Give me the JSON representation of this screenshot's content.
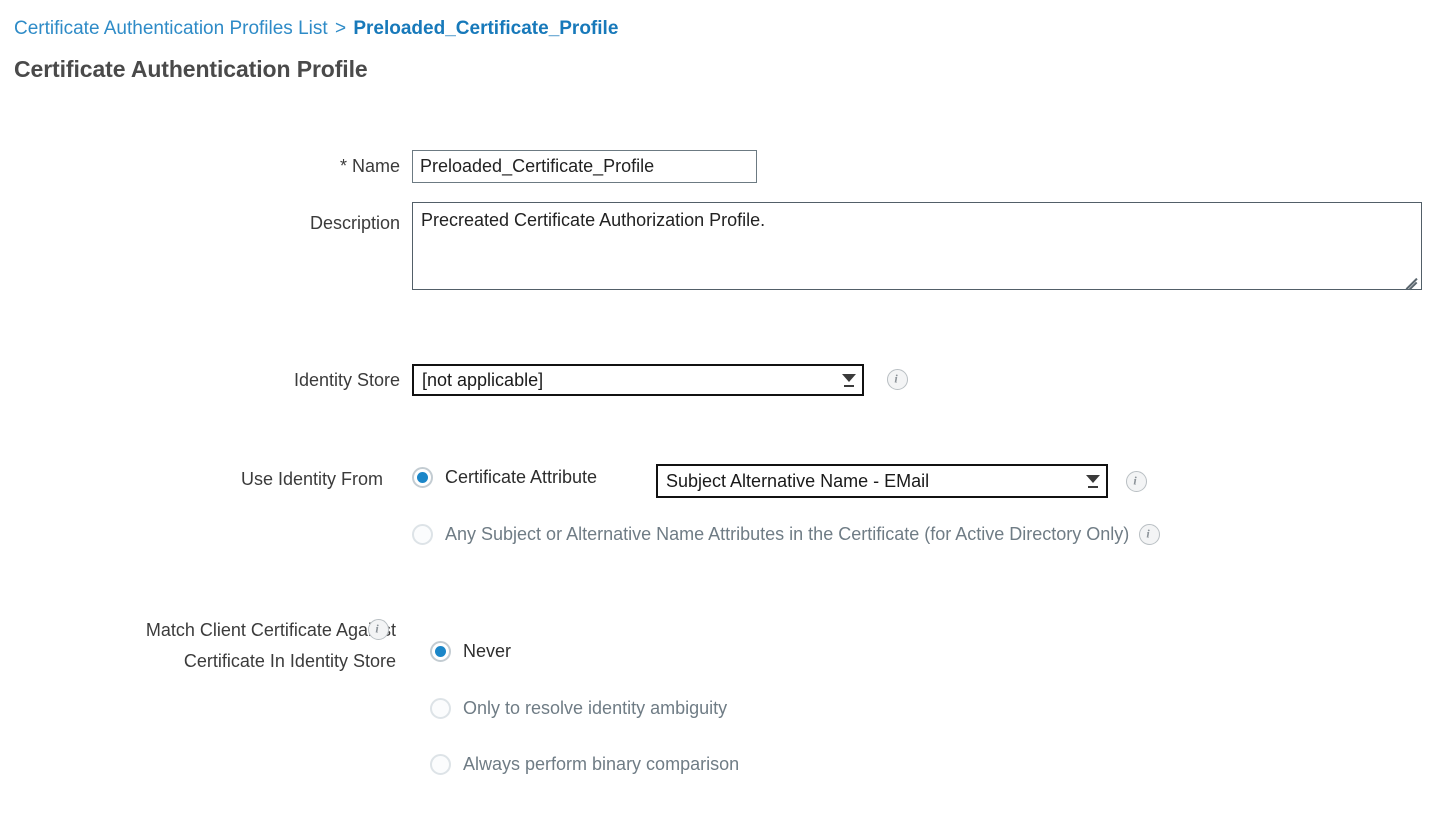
{
  "breadcrumb": {
    "parent": "Certificate Authentication Profiles List",
    "separator": ">",
    "current": "Preloaded_Certificate_Profile"
  },
  "page_title": "Certificate Authentication Profile",
  "form": {
    "name": {
      "label": "* Name",
      "value": "Preloaded_Certificate_Profile",
      "placeholder": ""
    },
    "description": {
      "label": "Description",
      "value": "Precreated Certificate Authorization Profile.",
      "placeholder": ""
    },
    "identity_store": {
      "label": "Identity Store",
      "value": "[not applicable]",
      "options": [
        "[not applicable]"
      ],
      "info_icon": "info-icon"
    },
    "use_identity_from": {
      "label": "Use Identity From",
      "option_certificate_attribute": {
        "label": "Certificate Attribute",
        "selected": true
      },
      "certificate_attribute_select": {
        "value": "Subject Alternative Name - EMail",
        "options": [
          "Subject Alternative Name - EMail"
        ],
        "info_icon": "info-icon"
      },
      "option_any_subject": {
        "label": "Any Subject or Alternative Name Attributes in the Certificate (for Active Directory Only)",
        "selected": false,
        "info_icon": "info-icon"
      }
    },
    "match_client_certificate": {
      "label_line1": "Match Client Certificate Against",
      "label_line2": "Certificate In Identity Store",
      "info_icon": "info-icon",
      "options": [
        {
          "label": "Never",
          "selected": true
        },
        {
          "label": "Only to resolve identity ambiguity",
          "selected": false
        },
        {
          "label": "Always perform binary comparison",
          "selected": false
        }
      ]
    }
  },
  "colors": {
    "link": "#2e8bc7",
    "link_current": "#1779ba",
    "title": "#4a4a4a",
    "radio_selected": "#1b86c8",
    "input_border": "#6c7a82",
    "select_border": "#111111"
  }
}
